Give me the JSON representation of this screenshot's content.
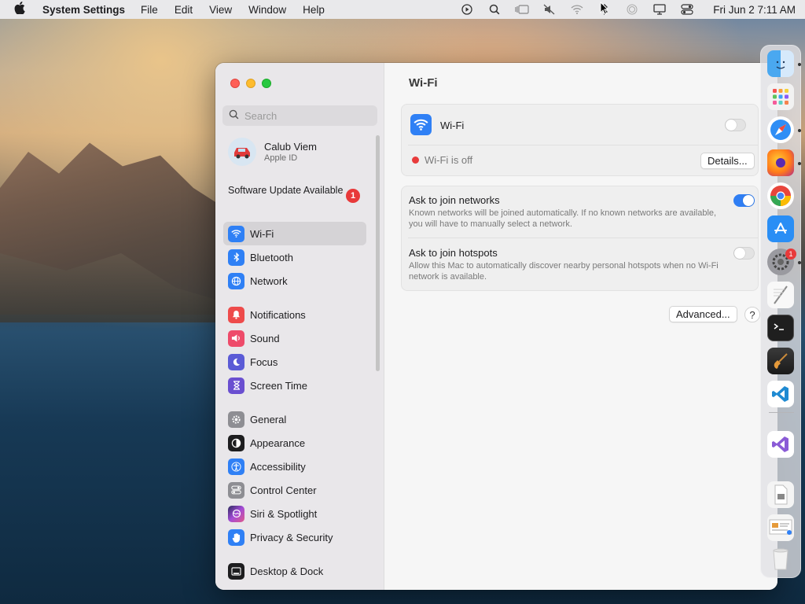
{
  "menubar": {
    "app_name": "System Settings",
    "menus": [
      "File",
      "Edit",
      "View",
      "Window",
      "Help"
    ],
    "clock": "Fri Jun 2  7:11 AM"
  },
  "sidebar": {
    "search_placeholder": "Search",
    "profile": {
      "name": "Calub Viem",
      "subtitle": "Apple ID"
    },
    "update": {
      "label": "Software Update Available",
      "badge": "1"
    },
    "items": [
      {
        "label": "Wi-Fi",
        "icon": "wifi-icon",
        "color": "#2f80f5"
      },
      {
        "label": "Bluetooth",
        "icon": "bluetooth-icon",
        "color": "#2f80f5"
      },
      {
        "label": "Network",
        "icon": "globe-icon",
        "color": "#2f80f5"
      },
      {
        "label": "Notifications",
        "icon": "bell-icon",
        "color": "#ee4b4b"
      },
      {
        "label": "Sound",
        "icon": "speaker-icon",
        "color": "#ee4b6a"
      },
      {
        "label": "Focus",
        "icon": "moon-icon",
        "color": "#5b5bd6"
      },
      {
        "label": "Screen Time",
        "icon": "hourglass-icon",
        "color": "#6a4fd0"
      },
      {
        "label": "General",
        "icon": "gear-icon",
        "color": "#8e8e93"
      },
      {
        "label": "Appearance",
        "icon": "appearance-icon",
        "color": "#1d1d1f"
      },
      {
        "label": "Accessibility",
        "icon": "accessibility-icon",
        "color": "#2f80f5"
      },
      {
        "label": "Control Center",
        "icon": "control-center-icon",
        "color": "#8e8e93"
      },
      {
        "label": "Siri & Spotlight",
        "icon": "siri-icon",
        "color": "#a34bd6"
      },
      {
        "label": "Privacy & Security",
        "icon": "hand-icon",
        "color": "#2f80f5"
      },
      {
        "label": "Desktop & Dock",
        "icon": "dock-icon",
        "color": "#1d1d1f"
      }
    ]
  },
  "content": {
    "title": "Wi-Fi",
    "wifi": {
      "label": "Wi-Fi",
      "enabled": false,
      "status": "Wi-Fi is off",
      "details_label": "Details..."
    },
    "ask_networks": {
      "title": "Ask to join networks",
      "description": "Known networks will be joined automatically. If no known networks are available, you will have to manually select a network.",
      "enabled": true
    },
    "ask_hotspots": {
      "title": "Ask to join hotspots",
      "description": "Allow this Mac to automatically discover nearby personal hotspots when no Wi-Fi network is available.",
      "enabled": false
    },
    "advanced_label": "Advanced...",
    "help_label": "?"
  },
  "dock": {
    "apps": [
      "finder-icon",
      "launchpad-icon",
      "safari-icon",
      "firefox-icon",
      "chrome-icon",
      "app-store-icon",
      "system-settings-icon",
      "textedit-icon",
      "terminal-icon",
      "garageband-icon",
      "vscode-icon",
      "visual-studio-icon",
      "file-icon",
      "document-icon",
      "trash-icon"
    ],
    "settings_badge": "1"
  }
}
